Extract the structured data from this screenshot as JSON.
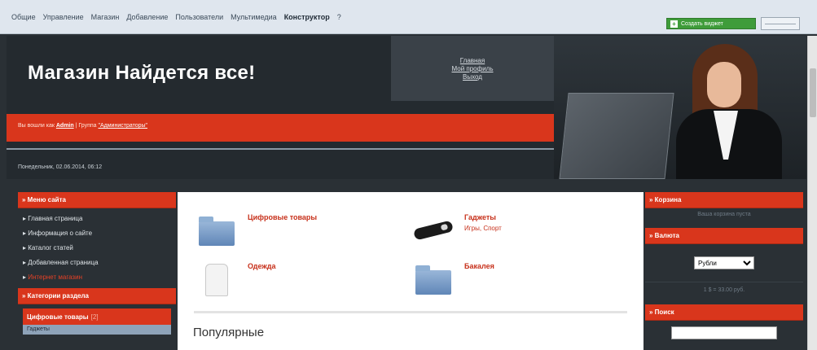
{
  "admin": {
    "menu": [
      "Общие",
      "Управление",
      "Магазин",
      "Добавление",
      "Пользователи",
      "Мультимедиа",
      "Конструктор",
      "?"
    ],
    "create_button": "Создать виджет"
  },
  "header": {
    "title": "Магазин Найдется все!",
    "links": [
      "Главная",
      "Мой профиль",
      "Выход"
    ],
    "logged_in_prefix": "Вы вошли как",
    "user": "Admin",
    "group_prefix": "| Группа",
    "group": "\"Администраторы\"",
    "date": "Понедельник, 02.06.2014, 06:12"
  },
  "left": {
    "menu_title": "» Меню сайта",
    "menu_items": [
      "Главная страница",
      "Информация о сайте",
      "Каталог статей",
      "Добавленная страница",
      "Интернет магазин"
    ],
    "active_index": 4,
    "categories_title": "» Категории раздела",
    "category_active": "Цифровые товары",
    "category_count": "[2]",
    "category_sub": "Гаджеты"
  },
  "content": {
    "categories": [
      {
        "name": "Цифровые товары",
        "subs": ""
      },
      {
        "name": "Гаджеты",
        "subs": "Игры, Спорт"
      },
      {
        "name": "Одежда",
        "subs": ""
      },
      {
        "name": "Бакалея",
        "subs": ""
      }
    ],
    "popular_title": "Популярные"
  },
  "right": {
    "cart_title": "» Корзина",
    "cart_empty": "Ваша корзина пуста",
    "currency_title": "» Валюта",
    "currency_selected": "Рубли",
    "rate": "1 $ = 33.00 руб.",
    "search_title": "» Поиск",
    "search_value": ""
  },
  "colors": {
    "accent": "#d9361c",
    "dark": "#242a2f",
    "link": "#c7301a"
  }
}
